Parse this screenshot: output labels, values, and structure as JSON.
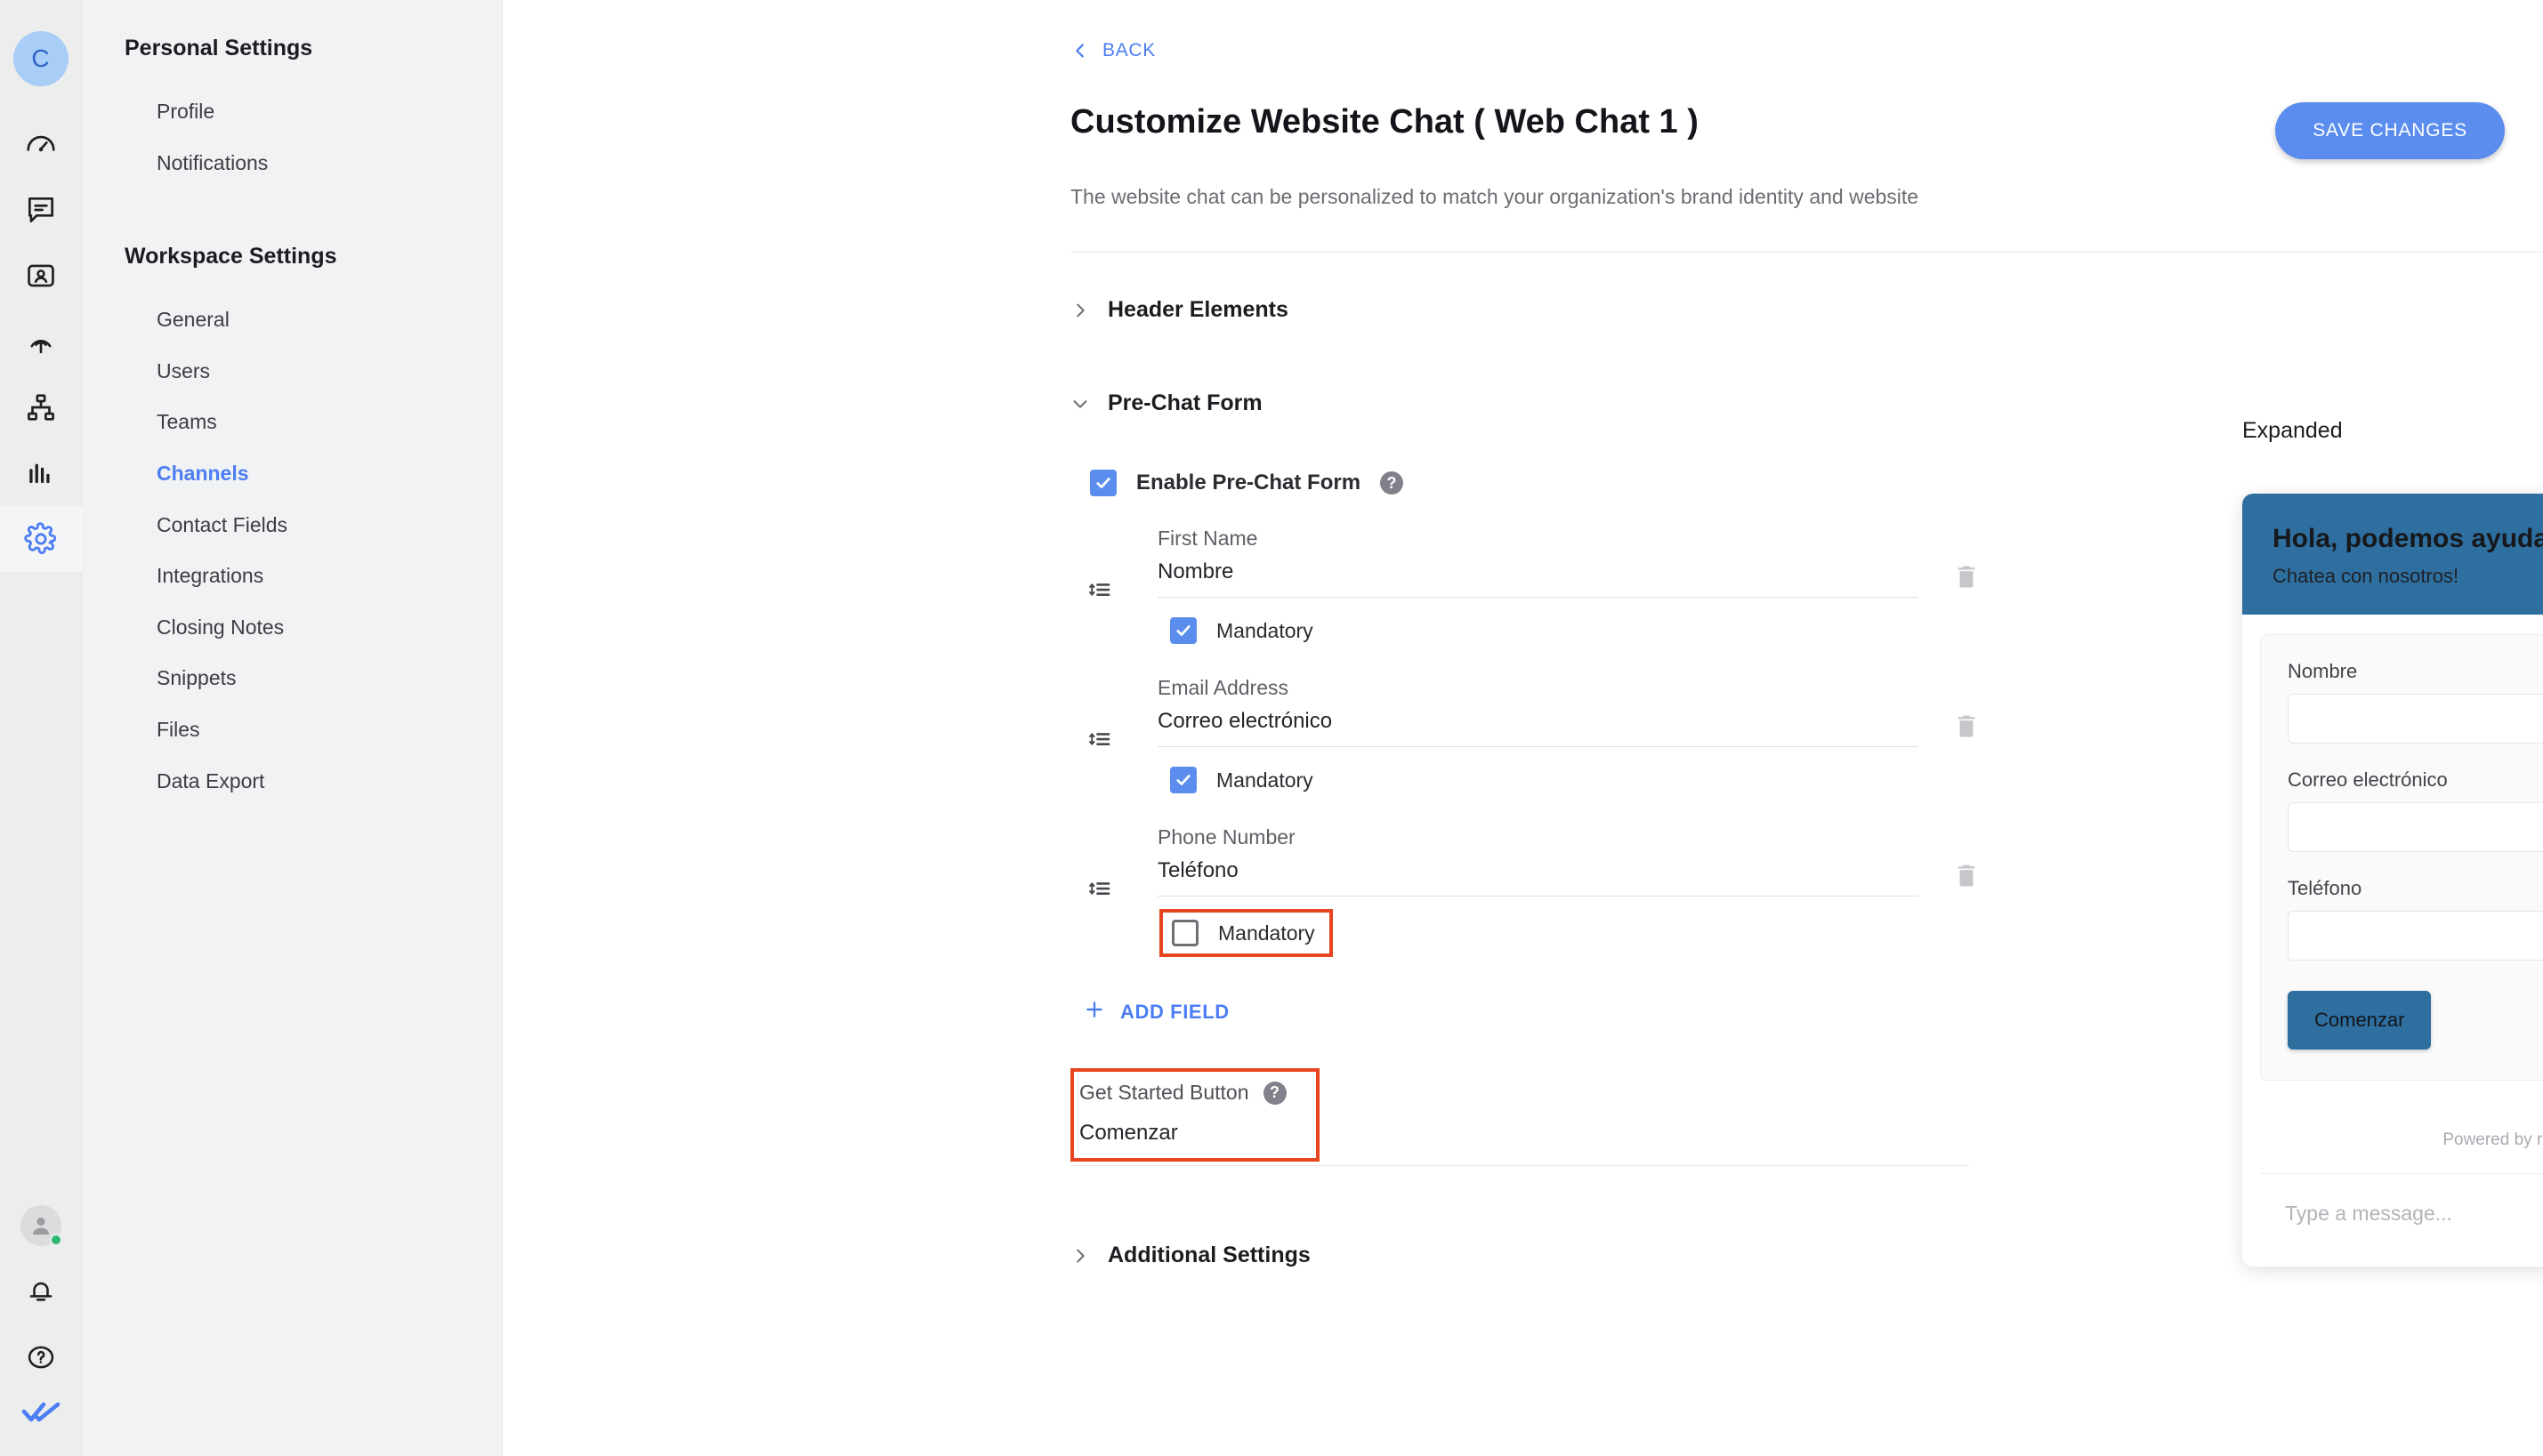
{
  "rail": {
    "avatar_initial": "C",
    "icons": [
      {
        "name": "dashboard-gauge-icon",
        "label": "Dashboard"
      },
      {
        "name": "messages-icon",
        "label": "Messages"
      },
      {
        "name": "contacts-icon",
        "label": "Contacts"
      },
      {
        "name": "broadcast-icon",
        "label": "Broadcasts"
      },
      {
        "name": "workflows-icon",
        "label": "Workflows"
      },
      {
        "name": "reports-icon",
        "label": "Reports"
      },
      {
        "name": "settings-gear-icon",
        "label": "Settings"
      }
    ],
    "bottom_icons": [
      {
        "name": "user-avatar-icon",
        "label": "Profile"
      },
      {
        "name": "bell-icon",
        "label": "Notifications"
      },
      {
        "name": "help-circle-icon",
        "label": "Help"
      },
      {
        "name": "respondio-logo-icon",
        "label": "respond.io"
      }
    ]
  },
  "nav": {
    "personal_title": "Personal Settings",
    "personal_items": [
      {
        "label": "Profile",
        "active": false
      },
      {
        "label": "Notifications",
        "active": false
      }
    ],
    "workspace_title": "Workspace Settings",
    "workspace_items": [
      {
        "label": "General",
        "active": false
      },
      {
        "label": "Users",
        "active": false
      },
      {
        "label": "Teams",
        "active": false
      },
      {
        "label": "Channels",
        "active": true
      },
      {
        "label": "Contact Fields",
        "active": false
      },
      {
        "label": "Integrations",
        "active": false
      },
      {
        "label": "Closing Notes",
        "active": false
      },
      {
        "label": "Snippets",
        "active": false
      },
      {
        "label": "Files",
        "active": false
      },
      {
        "label": "Data Export",
        "active": false
      }
    ]
  },
  "header": {
    "back_label": "BACK",
    "title": "Customize Website Chat ( Web Chat 1 )",
    "subtitle": "The website chat can be personalized to match your organization's brand identity and website",
    "save_label": "SAVE CHANGES"
  },
  "sections": {
    "header_elements": {
      "title": "Header Elements",
      "expanded": false
    },
    "pre_chat_form": {
      "title": "Pre-Chat Form",
      "expanded": true,
      "enable_label": "Enable Pre-Chat Form",
      "enable_checked": true,
      "help_glyph": "?",
      "fields": [
        {
          "label": "First Name",
          "value": "Nombre",
          "mandatory_label": "Mandatory",
          "mandatory_checked": true,
          "highlighted": false
        },
        {
          "label": "Email Address",
          "value": "Correo electrónico",
          "mandatory_label": "Mandatory",
          "mandatory_checked": true,
          "highlighted": false
        },
        {
          "label": "Phone Number",
          "value": "Teléfono",
          "mandatory_label": "Mandatory",
          "mandatory_checked": false,
          "highlighted": true
        }
      ],
      "add_field_label": "ADD FIELD",
      "get_started_button": {
        "label": "Get Started Button",
        "value": "Comenzar",
        "help_glyph": "?",
        "highlighted": true
      }
    },
    "additional_settings": {
      "title": "Additional Settings",
      "expanded": false
    }
  },
  "preview": {
    "title": "Expanded",
    "widget": {
      "header_title": "Hola, podemos ayudarte?",
      "header_subtitle": "Chatea con nosotros!",
      "close_icon": "close-icon",
      "fields": [
        {
          "label": "Nombre",
          "value": ""
        },
        {
          "label": "Correo electrónico",
          "value": ""
        },
        {
          "label": "Teléfono",
          "value": ""
        }
      ],
      "submit_label": "Comenzar",
      "powered_by": "Powered by respond.io",
      "compose_placeholder": "Type a message...",
      "attach_icon": "paperclip-icon",
      "send_icon": "send-icon"
    }
  },
  "colors": {
    "accent_blue": "#5b8def",
    "widget_blue": "#2e6fa0",
    "highlight_red": "#e8441f",
    "link_blue": "#4c7ef3",
    "online_green": "#2eb872"
  }
}
